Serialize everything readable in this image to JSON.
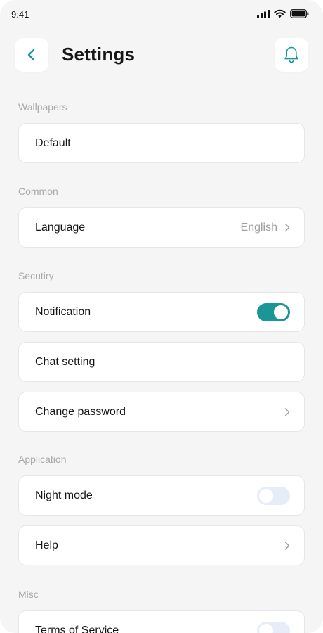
{
  "status_bar": {
    "time": "9:41"
  },
  "header": {
    "title": "Settings"
  },
  "sections": {
    "wallpapers": {
      "label": "Wallpapers",
      "items": [
        {
          "label": "Default"
        }
      ]
    },
    "common": {
      "label": "Common",
      "items": [
        {
          "label": "Language",
          "value": "English"
        }
      ]
    },
    "security": {
      "label": "Secutiry",
      "items": [
        {
          "label": "Notification",
          "toggle": "on"
        },
        {
          "label": "Chat setting"
        },
        {
          "label": "Change password"
        }
      ]
    },
    "application": {
      "label": "Application",
      "items": [
        {
          "label": "Night mode",
          "toggle": "off"
        },
        {
          "label": "Help"
        }
      ]
    },
    "misc": {
      "label": "Misc",
      "items": [
        {
          "label": "Terms of Service",
          "toggle": "off"
        }
      ]
    }
  },
  "colors": {
    "accent": "#1a9696",
    "toggle_off": "#e6edf8",
    "background": "#f5f5f5"
  },
  "icons": [
    "back-arrow-icon",
    "bell-icon",
    "chevron-right-icon",
    "signal-icon",
    "wifi-icon",
    "battery-icon"
  ]
}
